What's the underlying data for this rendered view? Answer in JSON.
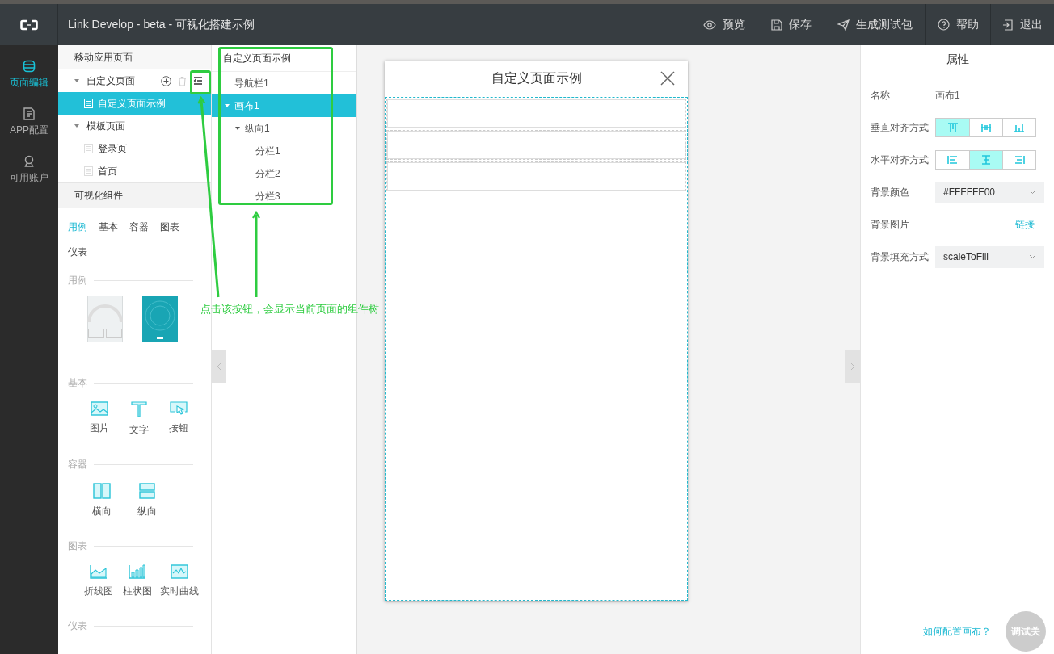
{
  "topbar": {
    "title": "Link Develop - beta - 可视化搭建示例",
    "actions": [
      {
        "kind": "preview",
        "label": "预览"
      },
      {
        "kind": "save",
        "label": "保存"
      },
      {
        "kind": "package",
        "label": "生成测试包"
      },
      {
        "kind": "help",
        "label": "帮助"
      },
      {
        "kind": "exit",
        "label": "退出"
      }
    ]
  },
  "rail": {
    "items": [
      {
        "kind": "pages",
        "label": "页面编辑",
        "selected": true
      },
      {
        "kind": "config",
        "label": "APP配置",
        "selected": false
      },
      {
        "kind": "account",
        "label": "可用账户",
        "selected": false
      }
    ]
  },
  "pages": {
    "header": "移动应用页面",
    "groups": [
      {
        "label": "自定义页面",
        "expanded": true,
        "children": [
          {
            "label": "自定义页面示例",
            "selected": true
          }
        ]
      },
      {
        "label": "模板页面",
        "expanded": true,
        "children": [
          {
            "label": "登录页",
            "selected": false
          },
          {
            "label": "首页",
            "selected": false
          }
        ]
      }
    ]
  },
  "components": {
    "header": "可视化组件",
    "tabs": [
      {
        "label": "用例",
        "selected": true
      },
      {
        "label": "基本",
        "selected": false
      },
      {
        "label": "容器",
        "selected": false
      },
      {
        "label": "图表",
        "selected": false
      },
      {
        "label": "仪表",
        "selected": false
      }
    ],
    "sections": [
      {
        "title": "用例",
        "kind": "examples",
        "items": [
          {
            "kind": "gauge"
          },
          {
            "kind": "teal"
          }
        ]
      },
      {
        "title": "基本",
        "kind": "icons",
        "items": [
          {
            "kind": "image",
            "label": "图片"
          },
          {
            "kind": "text",
            "label": "文字"
          },
          {
            "kind": "button",
            "label": "按钮"
          }
        ]
      },
      {
        "title": "容器",
        "kind": "icons",
        "items": [
          {
            "kind": "horizontal",
            "label": "横向"
          },
          {
            "kind": "vertical",
            "label": "纵向"
          }
        ]
      },
      {
        "title": "图表",
        "kind": "icons",
        "items": [
          {
            "kind": "line",
            "label": "折线图"
          },
          {
            "kind": "bar",
            "label": "柱状图"
          },
          {
            "kind": "realtime",
            "label": "实时曲线"
          }
        ]
      },
      {
        "title": "仪表",
        "kind": "icons"
      }
    ]
  },
  "tree": {
    "title": "自定义页面示例",
    "nodes": [
      {
        "label": "导航栏1",
        "selected": false
      },
      {
        "label": "画布1",
        "selected": true,
        "expanded": true,
        "children": [
          {
            "label": "纵向1",
            "selected": false,
            "expanded": true,
            "children": [
              {
                "label": "分栏1",
                "selected": false
              },
              {
                "label": "分栏2",
                "selected": false
              },
              {
                "label": "分栏3",
                "selected": false
              }
            ]
          }
        ]
      }
    ]
  },
  "canvas": {
    "title": "自定义页面示例"
  },
  "properties": {
    "title": "属性",
    "rows": [
      {
        "kind": "text",
        "label": "名称",
        "value": "画布1"
      },
      {
        "kind": "align",
        "label": "垂直对齐方式",
        "options": [
          {
            "kind": "top",
            "selected": true
          },
          {
            "kind": "middle",
            "selected": false
          },
          {
            "kind": "bottom",
            "selected": false
          }
        ]
      },
      {
        "kind": "align",
        "label": "水平对齐方式",
        "options": [
          {
            "kind": "left",
            "selected": false
          },
          {
            "kind": "center",
            "selected": true
          },
          {
            "kind": "right",
            "selected": false
          }
        ]
      },
      {
        "kind": "select",
        "label": "背景颜色",
        "value": "#FFFFFF00"
      },
      {
        "kind": "link",
        "label": "背景图片",
        "value": "链接"
      },
      {
        "kind": "select",
        "label": "背景填充方式",
        "value": "scaleToFill"
      }
    ],
    "help_link": "如何配置画布？",
    "debug_button": "调试关"
  },
  "annotation": {
    "caption": "点击该按钮，会显示当前页面的组件树"
  }
}
